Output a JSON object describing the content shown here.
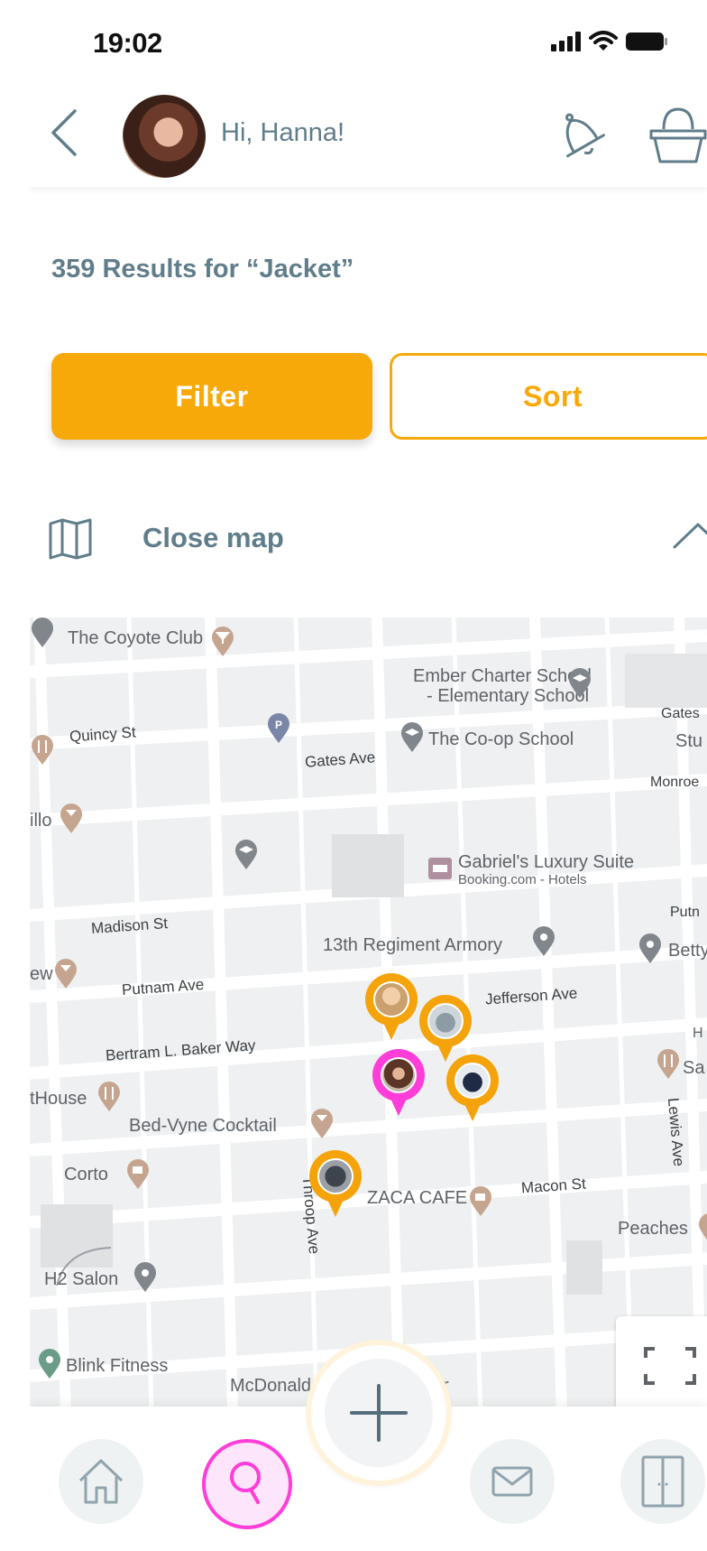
{
  "status_bar": {
    "time": "19:02"
  },
  "header": {
    "greeting": "Hi, Hanna!"
  },
  "results": {
    "text": "359 Results for “Jacket”"
  },
  "actions": {
    "filter_label": "Filter",
    "sort_label": "Sort"
  },
  "map_toggle": {
    "label": "Close map"
  },
  "map": {
    "labels": {
      "coyote": "The Coyote Club",
      "ember1": "Ember Charter School",
      "ember2": "- Elementary School",
      "coop": "The Co-op School",
      "gates_s": "Gates",
      "stu": "Stu",
      "monroe": "Monroe",
      "illo": "illo",
      "gabriels": "Gabriel's Luxury Suite",
      "booking": "Booking.com - Hotels",
      "putn": "Putn",
      "armory": "13th Regiment Armory",
      "betty": "Betty",
      "ew": "ew",
      "h": "H",
      "sa": "Sa",
      "thouse": "tHouse",
      "bedvyne": "Bed-Vyne Cocktail",
      "corto": "Corto",
      "zaca": "ZACA CAFE",
      "peaches": "Peaches",
      "h2salon": "H2 Salon",
      "blink": "Blink Fitness",
      "mcdonald": "McDonald",
      "r": "r"
    },
    "streets": {
      "quincy": "Quincy St",
      "gates_ave": "Gates Ave",
      "madison": "Madison St",
      "putnam": "Putnam Ave",
      "jefferson": "Jefferson Ave",
      "bertram": "Bertram L. Baker Way",
      "macon": "Macon St",
      "throop": "Throop Ave",
      "lewis": "Lewis Ave"
    },
    "pin_colors": {
      "item": "#f5a30a",
      "user": "#ff3dd8"
    }
  },
  "bottom_nav": {
    "items": [
      "home-icon",
      "search-icon",
      "add-icon",
      "mail-icon",
      "wardrobe-icon"
    ]
  },
  "colors": {
    "accent": "#f8a90a",
    "text": "#607d8b",
    "active": "#ff3dd8"
  }
}
